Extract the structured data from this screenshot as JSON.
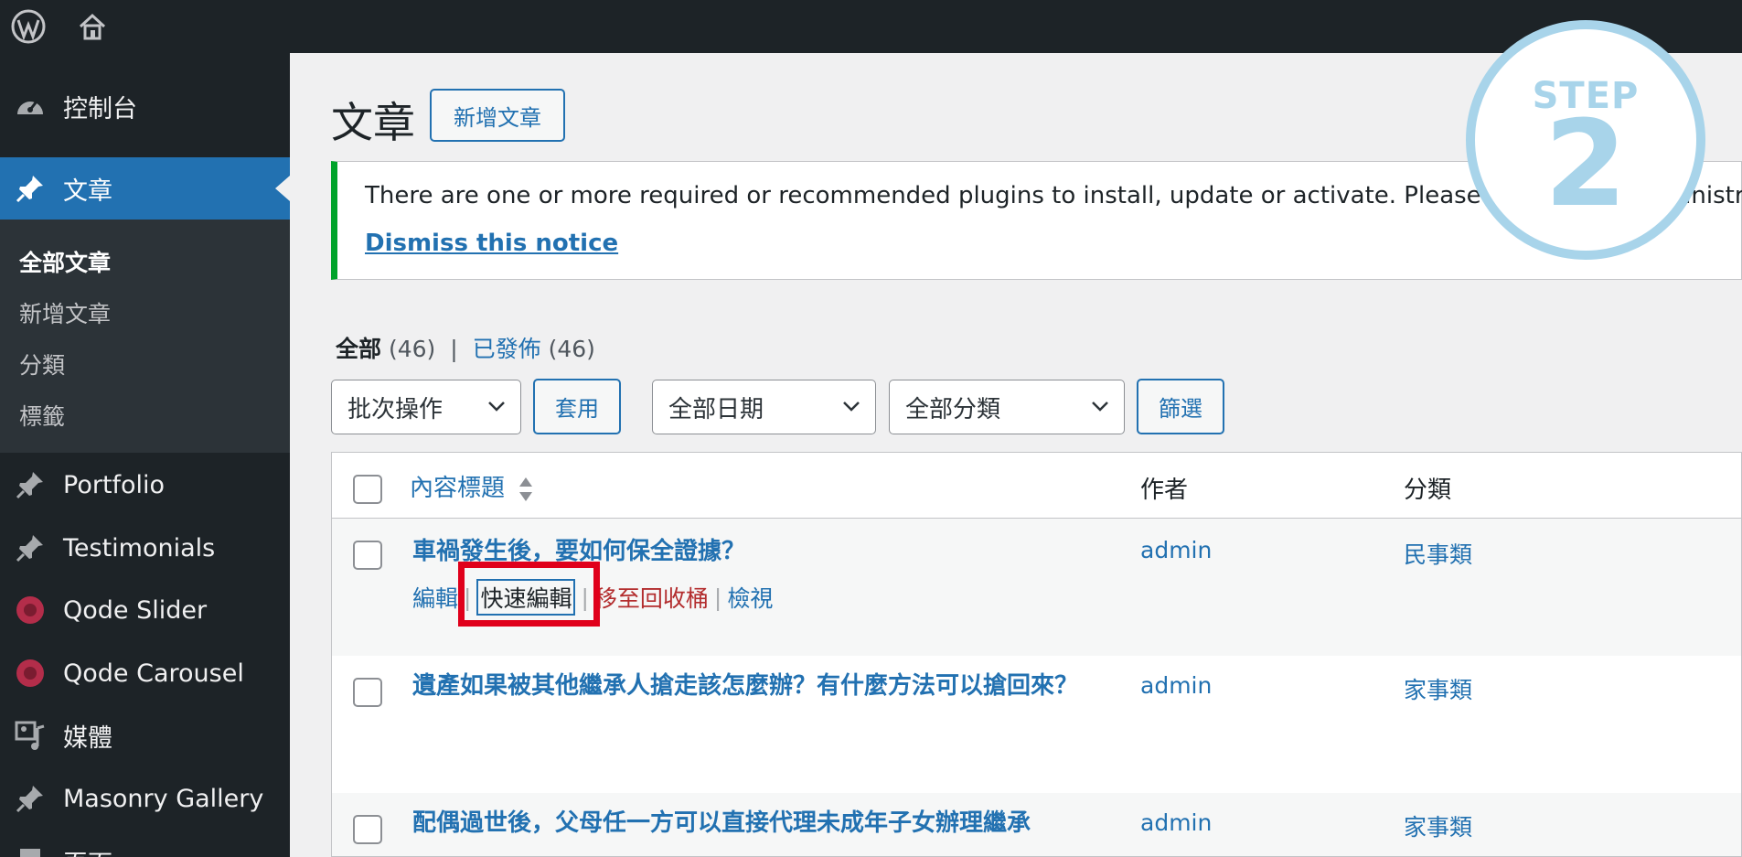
{
  "sidebar": {
    "menu": [
      {
        "label": "控制台",
        "icon": "dashboard-icon"
      },
      {
        "label": "文章",
        "icon": "pushpin-icon"
      },
      {
        "label": "Portfolio",
        "icon": "pushpin-icon"
      },
      {
        "label": "Testimonials",
        "icon": "pushpin-icon"
      },
      {
        "label": "Qode Slider",
        "icon": "slider-icon"
      },
      {
        "label": "Qode Carousel",
        "icon": "carousel-icon"
      },
      {
        "label": "媒體",
        "icon": "media-icon"
      },
      {
        "label": "Masonry Gallery",
        "icon": "pushpin-icon"
      },
      {
        "label": "頁面",
        "icon": "page-icon"
      }
    ],
    "submenu": [
      "全部文章",
      "新增文章",
      "分類",
      "標籤"
    ]
  },
  "header": {
    "title": "文章",
    "add_new": "新增文章"
  },
  "notice": {
    "message": "There are one or more required or recommended plugins to install, update or activate. Please contact the administrator",
    "dismiss": "Dismiss this notice"
  },
  "views": {
    "all_label": "全部",
    "all_count": "(46)",
    "sep": "|",
    "published_label": "已發佈",
    "published_count": "(46)"
  },
  "filters": {
    "bulk_action": "批次操作",
    "apply": "套用",
    "date": "全部日期",
    "category": "全部分類",
    "filter": "篩選"
  },
  "table": {
    "columns": {
      "title": "內容標題",
      "author": "作者",
      "category": "分類"
    },
    "rows": [
      {
        "title": "車禍發生後，要如何保全證據？",
        "author": "admin",
        "category": "民事類"
      },
      {
        "title": "遺產如果被其他繼承人搶走該怎麼辦？有什麼方法可以搶回來？",
        "author": "admin",
        "category": "家事類"
      },
      {
        "title": "配偶過世後，父母任一方可以直接代理未成年子女辦理繼承",
        "author": "admin",
        "category": "家事類"
      }
    ],
    "row_actions": {
      "edit": "編輯",
      "quick_edit": "快速編輯",
      "trash": "移至回收桶",
      "view": "檢視",
      "sep": "|"
    }
  },
  "step_badge": {
    "word": "STEP",
    "number": "2"
  },
  "colors": {
    "accent": "#2271b1",
    "sidebar": "#1d2327",
    "notice_border": "#00a32a",
    "highlight": "#e0001b",
    "badge": "#a8d4ea"
  }
}
